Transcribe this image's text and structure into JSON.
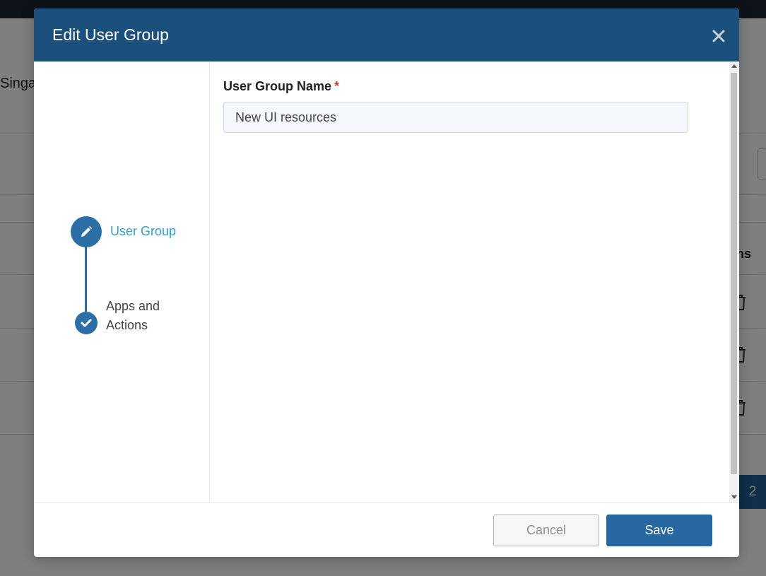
{
  "background": {
    "partial_text": "Singa",
    "partial_column": "ns",
    "pagination_current": "2"
  },
  "modal": {
    "title": "Edit User Group",
    "close_icon": "close-icon"
  },
  "stepper": {
    "steps": [
      {
        "label": "User Group",
        "icon": "pencil-icon",
        "state": "active"
      },
      {
        "label": "Apps and Actions",
        "icon": "check-icon",
        "state": "complete"
      }
    ],
    "colors": {
      "active_label": "#2aa3d6",
      "circle": "#2c6fa6"
    }
  },
  "form": {
    "group_name_label": "User Group Name",
    "required_mark": "*",
    "group_name_value": "New UI resources"
  },
  "footer": {
    "cancel_label": "Cancel",
    "save_label": "Save"
  },
  "colors": {
    "header": "#1b4f7c",
    "primary_button": "#2768a3"
  }
}
